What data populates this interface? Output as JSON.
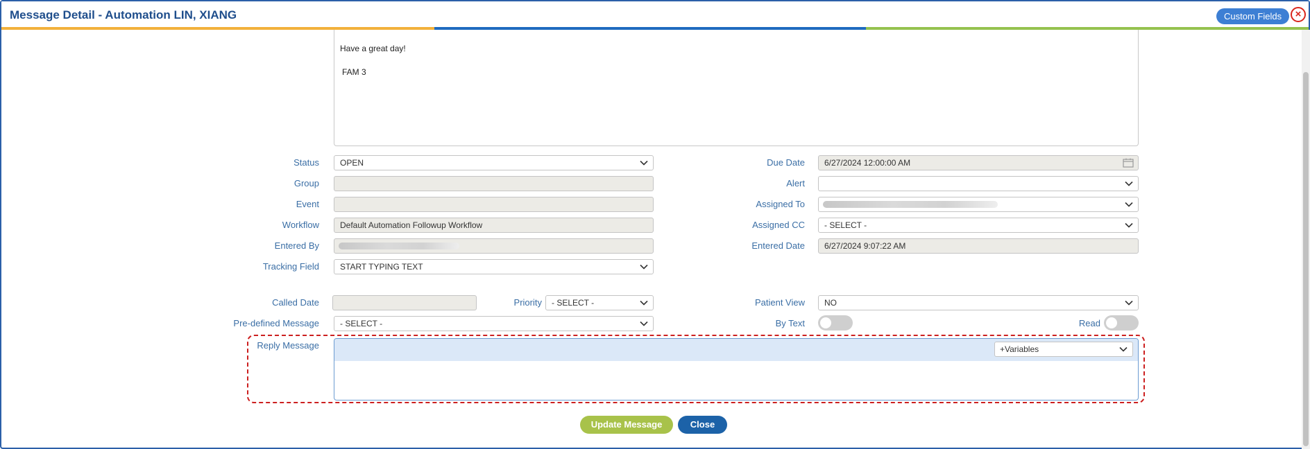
{
  "window": {
    "title": "Message Detail - Automation LIN, XIANG",
    "custom_fields_label": "Custom Fields",
    "close_glyph": "×"
  },
  "message": {
    "lines": [
      "Have a great day!",
      "FAM 3"
    ]
  },
  "form": {
    "status": {
      "label": "Status",
      "value": "OPEN"
    },
    "group": {
      "label": "Group",
      "value": ""
    },
    "event": {
      "label": "Event",
      "value": ""
    },
    "workflow": {
      "label": "Workflow",
      "value": "Default Automation Followup Workflow"
    },
    "entered_by": {
      "label": "Entered By",
      "value": ""
    },
    "tracking_field": {
      "label": "Tracking Field",
      "placeholder": "START TYPING TEXT"
    },
    "due_date": {
      "label": "Due Date",
      "value": "6/27/2024 12:00:00 AM"
    },
    "alert": {
      "label": "Alert",
      "value": ""
    },
    "assigned_to": {
      "label": "Assigned To",
      "value": ""
    },
    "assigned_cc": {
      "label": "Assigned CC",
      "value": "- SELECT -"
    },
    "entered_date": {
      "label": "Entered Date",
      "value": "6/27/2024 9:07:22 AM"
    },
    "called_date": {
      "label": "Called Date",
      "value": ""
    },
    "priority": {
      "label": "Priority",
      "value": "- SELECT -"
    },
    "patient_view": {
      "label": "Patient View",
      "value": "NO"
    },
    "predefined_message": {
      "label": "Pre-defined Message",
      "value": "- SELECT -"
    },
    "by_text": {
      "label": "By Text",
      "on": false
    },
    "read": {
      "label": "Read",
      "on": false
    },
    "reply_message": {
      "label": "Reply Message",
      "variables_label": "+Variables",
      "value": ""
    }
  },
  "buttons": {
    "update": "Update Message",
    "close": "Close"
  },
  "colors": {
    "accent_blue": "#1f4e8c",
    "label_blue": "#3a6ea5",
    "update_green": "#a8c24a",
    "close_blue": "#1c62a8",
    "highlight_red": "#cc1f1f",
    "strip_orange": "#f2b13b",
    "strip_blue": "#1f6bbf",
    "strip_green": "#95c24f"
  }
}
